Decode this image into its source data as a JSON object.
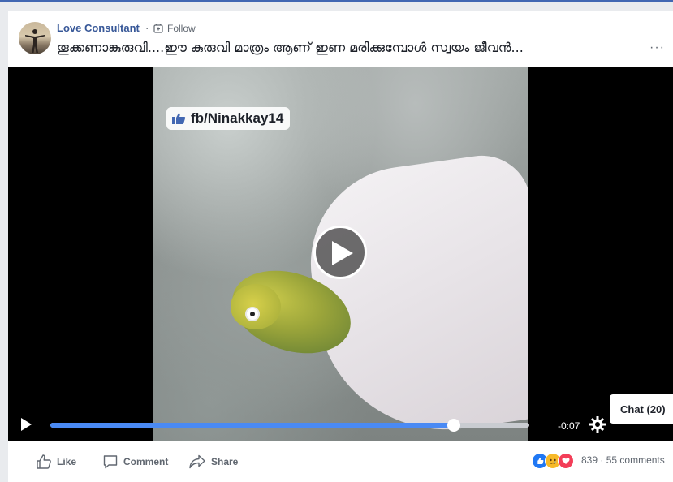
{
  "post": {
    "author": "Love Consultant",
    "separator": "·",
    "follow_label": "Follow",
    "title": "തൂക്കണാങ്കുരുവി....ഈ കുരുവി മാത്രം ആണ് ഇണ മരിക്കുമ്പോൾ സ്വയം ജീവൻ...",
    "more_label": "···"
  },
  "video": {
    "watermark": "fb/Ninakkay14",
    "time_remaining": "-0:07",
    "progress": 0.843
  },
  "chat": {
    "label": "Chat (20)"
  },
  "actions": {
    "like_label": "Like",
    "comment_label": "Comment",
    "share_label": "Share"
  },
  "stats": {
    "reactions_count": "839",
    "dot": "·",
    "comments": "55 comments"
  },
  "colors": {
    "accent": "#4267b2",
    "progress": "#4a8af4",
    "link": "#385898"
  }
}
